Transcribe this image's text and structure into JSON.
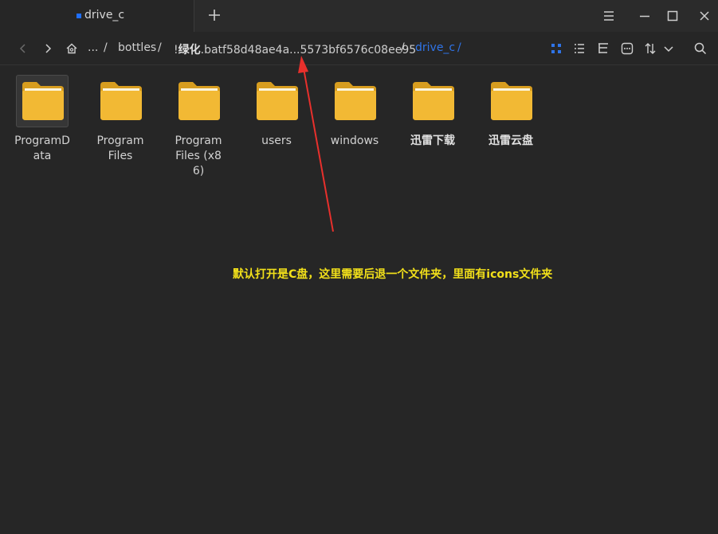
{
  "tab": {
    "title": "drive_c",
    "new_tab": "+"
  },
  "breadcrumb": {
    "ellipsis": "...",
    "separator": "/",
    "bottles": "bottles",
    "bottle_prefix": "!",
    "bottle_bold": "绿化",
    "bottle_rest": ".batf58d48ae4a...5573bf6576c08ee95",
    "current": "drive_c"
  },
  "items": [
    {
      "label": "ProgramData"
    },
    {
      "label": "Program Files"
    },
    {
      "label": "Program Files (x86)"
    },
    {
      "label": "users"
    },
    {
      "label": "windows"
    },
    {
      "label": "迅雷下载"
    },
    {
      "label": "迅雷云盘"
    }
  ],
  "annotation": {
    "text": "默认打开是C盘，这里需要后退一个文件夹，里面有icons文件夹",
    "color": "#f2e01a",
    "arrow_color": "#e8302c"
  },
  "colors": {
    "accent": "#2f74e8",
    "folder": "#f0b832"
  }
}
